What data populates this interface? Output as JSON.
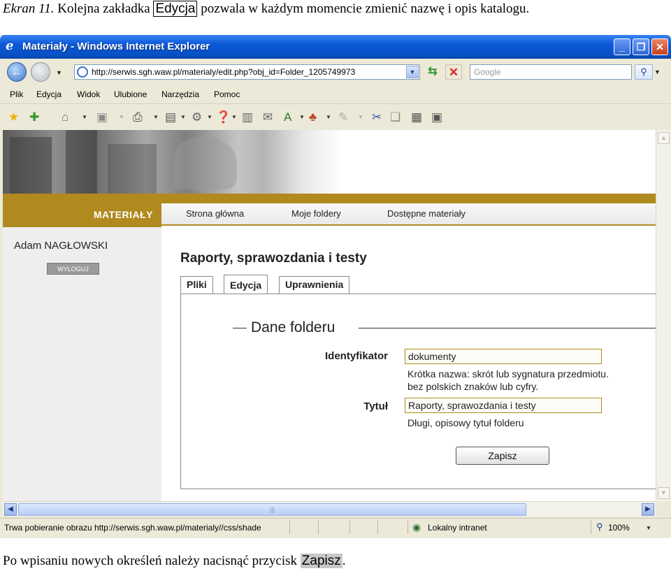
{
  "caption_top": {
    "prefix": "Ekran 11.",
    "text_before": " Kolejna zakładka ",
    "highlight": "Edycja",
    "text_after": " pozwala w każdym momencie zmienić nazwę i opis katalogu."
  },
  "caption_bottom": {
    "text_before": "Po wpisaniu nowych określeń należy nacisnąć przycisk ",
    "highlight": "Zapisz",
    "text_after": "."
  },
  "window": {
    "title": "Materiały - Windows Internet Explorer"
  },
  "addressbar": {
    "url": "http://serwis.sgh.waw.pl/materialy/edit.php?obj_id=Folder_1205749973",
    "search_placeholder": "Google"
  },
  "menu": [
    "Plik",
    "Edycja",
    "Widok",
    "Ulubione",
    "Narzędzia",
    "Pomoc"
  ],
  "site": {
    "brand": "MATERIAŁY",
    "nav": [
      "Strona główna",
      "Moje foldery",
      "Dostępne materiały"
    ],
    "user_name": "Adam NAGŁOWSKI",
    "logout_label": "WYLOGUJ"
  },
  "content": {
    "page_title": "Raporty, sprawozdania i testy",
    "tabs": [
      "Pliki",
      "Edycja",
      "Uprawnienia"
    ],
    "active_tab": "Edycja",
    "fieldset_legend": "Dane folderu",
    "fields": [
      {
        "label": "Identyfikator",
        "value": "dokumenty",
        "help_line1": "Krótka nazwa: skrót lub sygnatura przedmiotu.",
        "help_line2": "bez polskich znaków lub cyfry."
      },
      {
        "label": "Tytuł",
        "value": "Raporty, sprawozdania i testy",
        "help_line1": "Długi, opisowy tytuł folderu"
      }
    ],
    "submit_label": "Zapisz"
  },
  "statusbar": {
    "text": "Trwa pobieranie obrazu http://serwis.sgh.waw.pl/materialy//css/shade",
    "zone": "Lokalny intranet",
    "zoom": "100%"
  },
  "colors": {
    "brand_gold": "#b08a1e",
    "titlebar_blue": "#0a58d8"
  },
  "icons": {
    "back": "back-arrow-icon",
    "forward": "forward-arrow-icon",
    "refresh": "refresh-icon",
    "stop": "stop-icon",
    "search": "magnifier-icon"
  }
}
